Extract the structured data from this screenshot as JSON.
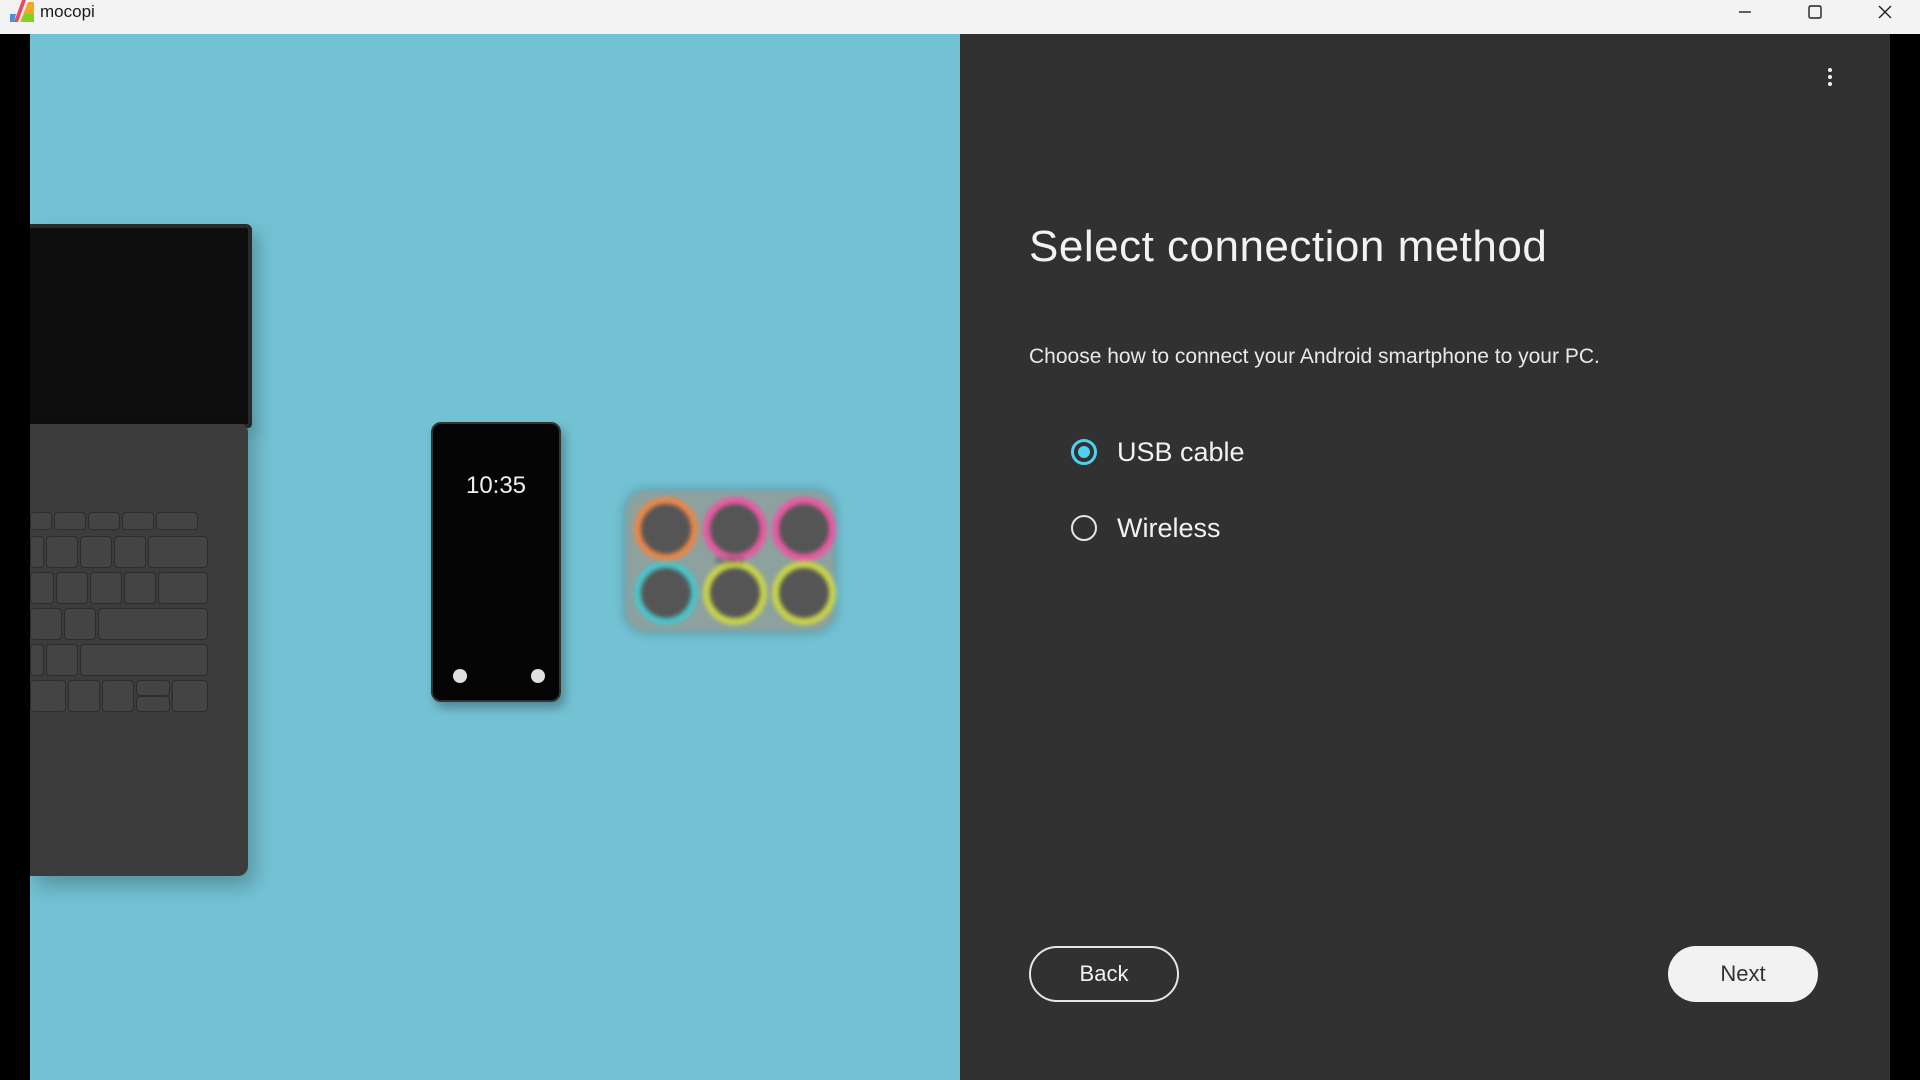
{
  "window": {
    "app_title": "mocopi",
    "controls": {
      "minimize": "minimize",
      "maximize": "maximize",
      "close": "close"
    }
  },
  "illustration": {
    "phone_time": "10:35",
    "case_brand": "SONY",
    "sensor_colors": [
      "#e8874a",
      "#e85aa3",
      "#e85aa3",
      "#4cc3c9",
      "#c8d44a",
      "#c8d44a"
    ]
  },
  "main": {
    "title": "Select connection method",
    "subtitle": "Choose how to connect your Android smartphone to your PC.",
    "options": [
      {
        "label": "USB cable",
        "selected": true
      },
      {
        "label": "Wireless",
        "selected": false
      }
    ],
    "back_label": "Back",
    "next_label": "Next"
  },
  "colors": {
    "accent": "#4fd0ee",
    "left_background": "#73c2d4",
    "right_background": "#313131"
  }
}
